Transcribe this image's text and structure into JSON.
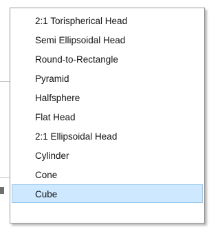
{
  "dropdown": {
    "items": [
      {
        "label": "2:1 Torispherical Head",
        "selected": false
      },
      {
        "label": "Semi Ellipsoidal Head",
        "selected": false
      },
      {
        "label": "Round-to-Rectangle",
        "selected": false
      },
      {
        "label": "Pyramid",
        "selected": false
      },
      {
        "label": "Halfsphere",
        "selected": false
      },
      {
        "label": "Flat Head",
        "selected": false
      },
      {
        "label": "2:1 Ellipsoidal Head",
        "selected": false
      },
      {
        "label": "Cylinder",
        "selected": false
      },
      {
        "label": "Cone",
        "selected": false
      },
      {
        "label": "Cube",
        "selected": true
      }
    ],
    "selected_value": "Cube",
    "colors": {
      "highlight_fill": "#cde8ff",
      "highlight_border": "#99c9f0",
      "border": "#979797",
      "text": "#111111"
    }
  }
}
